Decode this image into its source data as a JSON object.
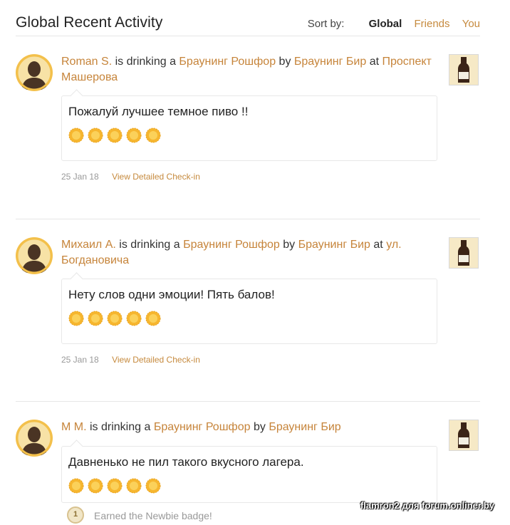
{
  "header": {
    "title": "Global Recent Activity",
    "sort_label": "Sort by:",
    "sort_options": [
      "Global",
      "Friends",
      "You"
    ]
  },
  "colors": {
    "link": "#c6843a",
    "avatar_bg": "#f3c04b",
    "cap": "#f6b62f"
  },
  "activity": [
    {
      "user": "Roman S.",
      "is_drinking": "is drinking a",
      "beer": "Браунинг Рошфор",
      "by": "by",
      "brewery": "Браунинг Бир",
      "at": "at",
      "venue": "Проспект Машерова",
      "comment": "Пожалуй лучшее темное пиво !!",
      "rating": 5,
      "date": "25 Jan 18",
      "view_link": "View Detailed Check-in"
    },
    {
      "user": "Михаил А.",
      "is_drinking": "is drinking a",
      "beer": "Браунинг Рошфор",
      "by": "by",
      "brewery": "Браунинг Бир",
      "at": "at",
      "venue": "ул. Богдановича",
      "comment": "Нету слов одни эмоции! Пять балов!",
      "rating": 5,
      "date": "25 Jan 18",
      "view_link": "View Detailed Check-in"
    },
    {
      "user": "M M.",
      "is_drinking": "is drinking a",
      "beer": "Браунинг Рошфор",
      "by": "by",
      "brewery": "Браунинг Бир",
      "comment": "Давненько не пил такого вкусного лагера.",
      "rating": 5,
      "badge": {
        "level": "1",
        "text": "Earned the Newbie badge!"
      }
    }
  ],
  "watermark": "flamron2 для forum.onliner.by"
}
